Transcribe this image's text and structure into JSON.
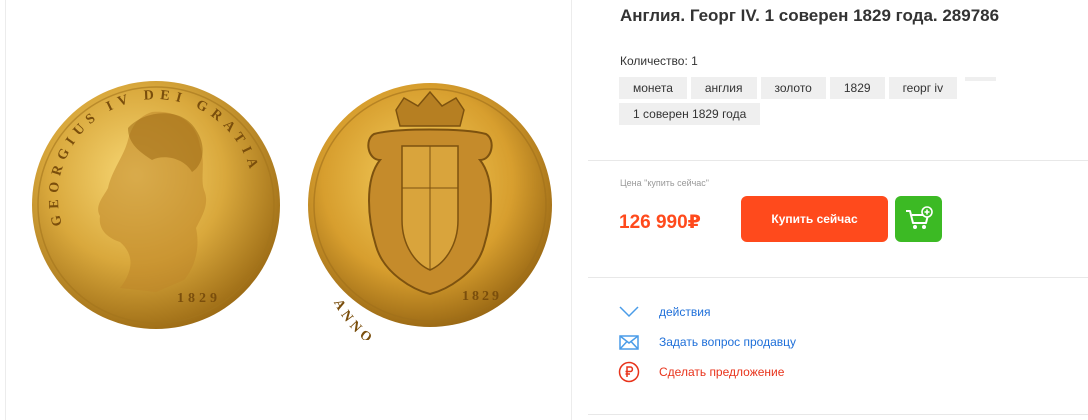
{
  "lot": {
    "title": "Англия. Георг IV. 1 соверен 1829 года. 289786",
    "quantity": "Количество: 1"
  },
  "coin": {
    "obverse_legend_left": "GEORGIUS",
    "obverse_legend_top": "IV DEI",
    "obverse_legend_right": "GRATIA",
    "obverse_year": "1829",
    "reverse_legend_left": "ANNO",
    "reverse_year": "1829"
  },
  "tags": [
    "монета",
    "англия",
    "золото",
    "1829",
    "георг iv",
    "1 соверен 1829 года"
  ],
  "purchase": {
    "price_caption": "Цена \"купить сейчас\"",
    "price": "126 990₽",
    "buy_now_label": "Купить сейчас",
    "price_color": "#ff4a1c",
    "cart_color": "#3cba24"
  },
  "actions": [
    {
      "label": "действия",
      "icon": "chevron-down-icon"
    },
    {
      "label": "Задать вопрос продавцу",
      "icon": "envelope-icon"
    },
    {
      "label": "Сделать предложение",
      "icon": "ruble-circle-icon"
    }
  ]
}
